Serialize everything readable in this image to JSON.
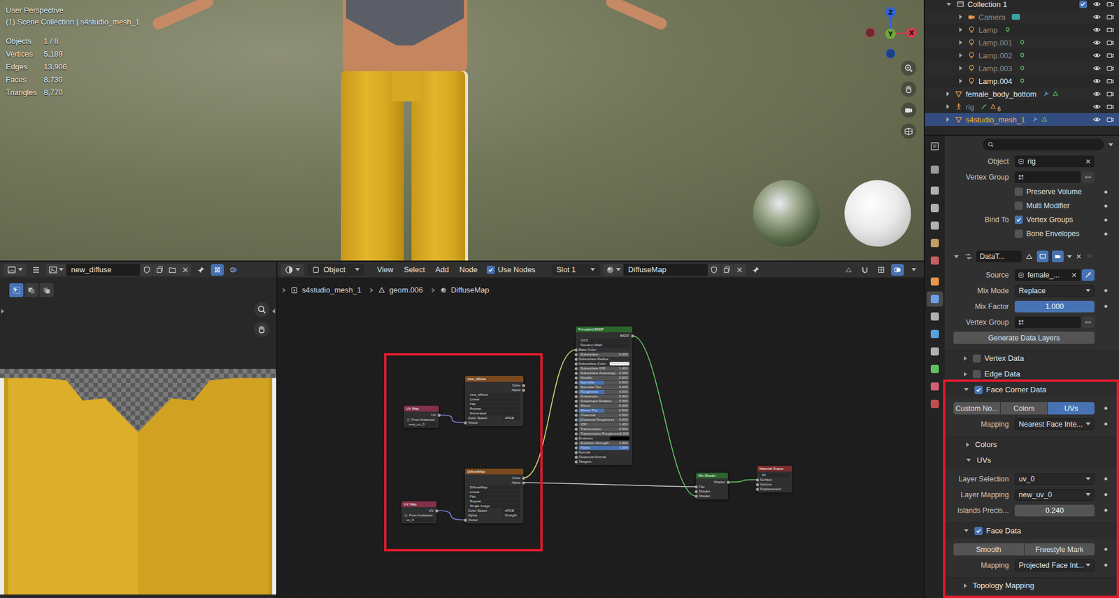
{
  "viewport": {
    "view": "User Perspective",
    "context": "(1) Scene Collection | s4studio_mesh_1",
    "stats": [
      {
        "label": "Objects",
        "value": "1 / 8"
      },
      {
        "label": "Vertices",
        "value": "5,189"
      },
      {
        "label": "Edges",
        "value": "13,906"
      },
      {
        "label": "Faces",
        "value": "8,730"
      },
      {
        "label": "Triangles",
        "value": "8,770"
      }
    ],
    "gizmo": {
      "x": "X",
      "y": "Y",
      "z": "Z"
    }
  },
  "outliner": {
    "rows": [
      {
        "name": "Collection 1",
        "kind": "collection",
        "depth": 0,
        "expanded": true,
        "dimmed": false,
        "selected": false,
        "included": true,
        "badge": ""
      },
      {
        "name": "Camera",
        "kind": "camera",
        "depth": 1,
        "expanded": false,
        "dimmed": true,
        "selected": false,
        "badge": ""
      },
      {
        "name": "Lamp",
        "kind": "lamp",
        "depth": 1,
        "expanded": false,
        "dimmed": true,
        "selected": false,
        "badge": ""
      },
      {
        "name": "Lamp.001",
        "kind": "lamp",
        "depth": 1,
        "expanded": false,
        "dimmed": true,
        "selected": false,
        "badge": ""
      },
      {
        "name": "Lamp.002",
        "kind": "lamp",
        "depth": 1,
        "expanded": false,
        "dimmed": true,
        "selected": false,
        "badge": ""
      },
      {
        "name": "Lamp.003",
        "kind": "lamp",
        "depth": 1,
        "expanded": false,
        "dimmed": true,
        "selected": false,
        "badge": ""
      },
      {
        "name": "Lamp.004",
        "kind": "lamp",
        "depth": 1,
        "expanded": false,
        "dimmed": false,
        "selected": false,
        "badge": ""
      },
      {
        "name": "female_body_bottom",
        "kind": "mesh",
        "depth": 0,
        "expanded": false,
        "dimmed": false,
        "selected": false,
        "badge": ""
      },
      {
        "name": "rig",
        "kind": "armature",
        "depth": 0,
        "expanded": false,
        "dimmed": true,
        "selected": false,
        "badge": "6"
      },
      {
        "name": "s4studio_mesh_1",
        "kind": "mesh",
        "depth": 0,
        "expanded": false,
        "dimmed": false,
        "selected": true,
        "badge": ""
      }
    ]
  },
  "properties": {
    "tabs": [
      {
        "selected": false
      },
      {
        "selected": false
      },
      {
        "selected": false
      },
      {
        "selected": false
      },
      {
        "selected": false
      },
      {
        "selected": false
      },
      {
        "selected": false
      },
      {
        "selected": true
      },
      {
        "selected": false
      },
      {
        "selected": false
      },
      {
        "selected": false
      },
      {
        "selected": false
      },
      {
        "selected": false
      },
      {
        "selected": false
      }
    ],
    "rows": [
      {
        "kind": "field",
        "label": "Object",
        "value": "rig",
        "clear": true,
        "invert": false,
        "eyedropper": false,
        "dot": false
      },
      {
        "kind": "field",
        "label": "Vertex Group",
        "value": "",
        "clear": false,
        "invert": true,
        "eyedropper": false,
        "dot": false
      },
      {
        "kind": "check",
        "label": "",
        "text": "Preserve Volume",
        "checked": false,
        "dot": true
      },
      {
        "kind": "check",
        "label": "",
        "text": "Multi Modifier",
        "checked": false,
        "dot": true
      },
      {
        "kind": "check",
        "label": "Bind To",
        "text": "Vertex Groups",
        "checked": true,
        "dot": true
      },
      {
        "kind": "check",
        "label": "",
        "text": "Bone Envelopes",
        "checked": false,
        "dot": true
      },
      {
        "kind": "modifier",
        "name": "DataT...",
        "expanded": true
      },
      {
        "kind": "field",
        "label": "Source",
        "value": "female_...",
        "clear": true,
        "invert": false,
        "eyedropper": true,
        "dot": false
      },
      {
        "kind": "dropdown",
        "label": "Mix Mode",
        "value": "Replace",
        "dot": true
      },
      {
        "kind": "slider",
        "label": "Mix Factor",
        "value": "1.000",
        "level": 1,
        "dot": true
      },
      {
        "kind": "field",
        "label": "Vertex Group",
        "value": "",
        "clear": false,
        "invert": true,
        "eyedropper": false,
        "dot": false
      },
      {
        "kind": "button",
        "label": "Generate Data Layers"
      },
      {
        "kind": "subpanel",
        "label": "Vertex Data",
        "checkbox": true,
        "checked": false,
        "expanded": false,
        "nested": false
      },
      {
        "kind": "subpanel",
        "label": "Edge Data",
        "checkbox": true,
        "checked": false,
        "expanded": false,
        "nested": false
      },
      {
        "kind": "subpanel",
        "label": "Face Corner Data",
        "checkbox": true,
        "checked": true,
        "expanded": true,
        "nested": false
      },
      {
        "kind": "segmented",
        "options": [
          {
            "label": "Custom No...",
            "selected": false
          },
          {
            "label": "Colors",
            "selected": false
          },
          {
            "label": "UVs",
            "selected": true
          }
        ]
      },
      {
        "kind": "dropdown",
        "label": "Mapping",
        "value": "Nearest Face Inte...",
        "dot": true
      },
      {
        "kind": "subpanel",
        "label": "Colors",
        "checkbox": false,
        "checked": false,
        "expanded": false,
        "nested": true
      },
      {
        "kind": "subpanel",
        "label": "UVs",
        "checkbox": false,
        "checked": false,
        "expanded": true,
        "nested": true
      },
      {
        "kind": "dropdown",
        "label": "Layer Selection",
        "value": "uv_0",
        "dot": true
      },
      {
        "kind": "dropdown",
        "label": "Layer Mapping",
        "value": "new_uv_0",
        "dot": true
      },
      {
        "kind": "number",
        "label": "Islands Precis...",
        "value": "0.240",
        "dot": true
      },
      {
        "kind": "subpanel",
        "label": "Face Data",
        "checkbox": true,
        "checked": true,
        "expanded": true,
        "nested": false
      },
      {
        "kind": "segmented",
        "options": [
          {
            "label": "Smooth",
            "selected": false
          },
          {
            "label": "Freestyle Mark",
            "selected": false
          }
        ]
      },
      {
        "kind": "dropdown",
        "label": "Mapping",
        "value": "Projected Face Int...",
        "dot": true
      },
      {
        "kind": "subpanel",
        "label": "Topology Mapping",
        "checkbox": false,
        "checked": false,
        "expanded": false,
        "nested": false
      }
    ]
  },
  "image_editor": {
    "image": "new_diffuse"
  },
  "node_editor": {
    "mode": "Object",
    "menus": [
      "View",
      "Select",
      "Add",
      "Node"
    ],
    "use_nodes": {
      "label": "Use Nodes",
      "checked": true
    },
    "slot": "Slot 1",
    "material": "DiffuseMap",
    "breadcrumbs": [
      "s4studio_mesh_1",
      "geom.006",
      "DiffuseMap"
    ],
    "nodes": [
      {
        "title": "UV Map",
        "color": "#83314a",
        "rows": [
          {
            "kind": "out",
            "text": "UV"
          },
          {
            "kind": "check",
            "text": "From Instancer",
            "checked": false
          },
          {
            "kind": "field",
            "text": "new_uv_0"
          }
        ]
      },
      {
        "title": "new_diffuse",
        "color": "#7a4a1e",
        "rows": [
          {
            "kind": "out",
            "text": "Color"
          },
          {
            "kind": "out",
            "text": "Alpha"
          },
          {
            "kind": "field",
            "text": "new_diffuse"
          },
          {
            "kind": "field",
            "text": "Linear"
          },
          {
            "kind": "field",
            "text": "Flat"
          },
          {
            "kind": "field",
            "text": "Repeat"
          },
          {
            "kind": "field",
            "text": "Generated"
          },
          {
            "kind": "prop",
            "text": "Color Space",
            "value": "sRGB"
          },
          {
            "kind": "in",
            "text": "Vector"
          }
        ]
      },
      {
        "title": "UV Map",
        "color": "#83314a",
        "rows": [
          {
            "kind": "out",
            "text": "UV"
          },
          {
            "kind": "check",
            "text": "From Instancer",
            "checked": false
          },
          {
            "kind": "field",
            "text": "uv_0"
          }
        ]
      },
      {
        "title": "DiffuseMap",
        "color": "#7a4a1e",
        "rows": [
          {
            "kind": "out",
            "text": "Color"
          },
          {
            "kind": "out",
            "text": "Alpha"
          },
          {
            "kind": "field",
            "text": "DiffuseMap"
          },
          {
            "kind": "field",
            "text": "Linear"
          },
          {
            "kind": "field",
            "text": "Flat"
          },
          {
            "kind": "field",
            "text": "Repeat"
          },
          {
            "kind": "field",
            "text": "Single Image"
          },
          {
            "kind": "prop",
            "text": "Color Space",
            "value": "sRGB"
          },
          {
            "kind": "prop",
            "text": "Alpha",
            "value": "Straight"
          },
          {
            "kind": "in",
            "text": "Vector"
          }
        ]
      },
      {
        "title": "Principled BSDF",
        "color": "#2b652b",
        "rows": [
          {
            "kind": "out",
            "text": "BSDF"
          },
          {
            "kind": "field",
            "text": "GGX"
          },
          {
            "kind": "field",
            "text": "Random Walk"
          },
          {
            "kind": "in",
            "text": "Base Color"
          },
          {
            "kind": "value",
            "text": "Subsurface",
            "value": "0.000",
            "level": 0
          },
          {
            "kind": "in",
            "text": "Subsurface Radius"
          },
          {
            "kind": "swatch",
            "text": "Subsurface Color",
            "color": "#e6e6e6"
          },
          {
            "kind": "value",
            "text": "Subsurface IOR",
            "value": "1.400",
            "level": 0
          },
          {
            "kind": "value",
            "text": "Subsurface Anisotropy",
            "value": "0.000",
            "level": 0
          },
          {
            "kind": "value",
            "text": "Metallic",
            "value": "0.000",
            "level": 0
          },
          {
            "kind": "value",
            "text": "Specular",
            "value": "0.500",
            "level": 0.5
          },
          {
            "kind": "value",
            "text": "Specular Tint",
            "value": "0.000",
            "level": 0
          },
          {
            "kind": "value",
            "text": "Roughness",
            "value": "0.500",
            "level": 0.5
          },
          {
            "kind": "value",
            "text": "Anisotropic",
            "value": "0.000",
            "level": 0
          },
          {
            "kind": "value",
            "text": "Anisotropic Rotation",
            "value": "0.000",
            "level": 0
          },
          {
            "kind": "value",
            "text": "Sheen",
            "value": "0.000",
            "level": 0
          },
          {
            "kind": "value",
            "text": "Sheen Tint",
            "value": "0.500",
            "level": 0.5
          },
          {
            "kind": "value",
            "text": "Clearcoat",
            "value": "0.000",
            "level": 0
          },
          {
            "kind": "value",
            "text": "Clearcoat Roughness",
            "value": "0.030",
            "level": 0.03
          },
          {
            "kind": "value",
            "text": "IOR",
            "value": "1.450",
            "level": 0
          },
          {
            "kind": "value",
            "text": "Transmission",
            "value": "0.000",
            "level": 0
          },
          {
            "kind": "value",
            "text": "Transmission Roughness",
            "value": "0.000",
            "level": 0
          },
          {
            "kind": "swatch",
            "text": "Emission",
            "color": "#000000"
          },
          {
            "kind": "value",
            "text": "Emission Strength",
            "value": "1.000",
            "level": 0
          },
          {
            "kind": "value",
            "text": "Alpha",
            "value": "1.000",
            "level": 1
          },
          {
            "kind": "in",
            "text": "Normal"
          },
          {
            "kind": "in",
            "text": "Clearcoat Normal"
          },
          {
            "kind": "in",
            "text": "Tangent"
          }
        ]
      },
      {
        "title": "Mix Shader",
        "color": "#2b652b",
        "rows": [
          {
            "kind": "out",
            "text": "Shader"
          },
          {
            "kind": "in",
            "text": "Fac"
          },
          {
            "kind": "in",
            "text": "Shader"
          },
          {
            "kind": "in",
            "text": "Shader"
          }
        ]
      },
      {
        "title": "Material Output",
        "color": "#7a2b2b",
        "rows": [
          {
            "kind": "field",
            "text": "All"
          },
          {
            "kind": "in",
            "text": "Surface"
          },
          {
            "kind": "in",
            "text": "Volume"
          },
          {
            "kind": "in",
            "text": "Displacement"
          }
        ]
      }
    ]
  }
}
